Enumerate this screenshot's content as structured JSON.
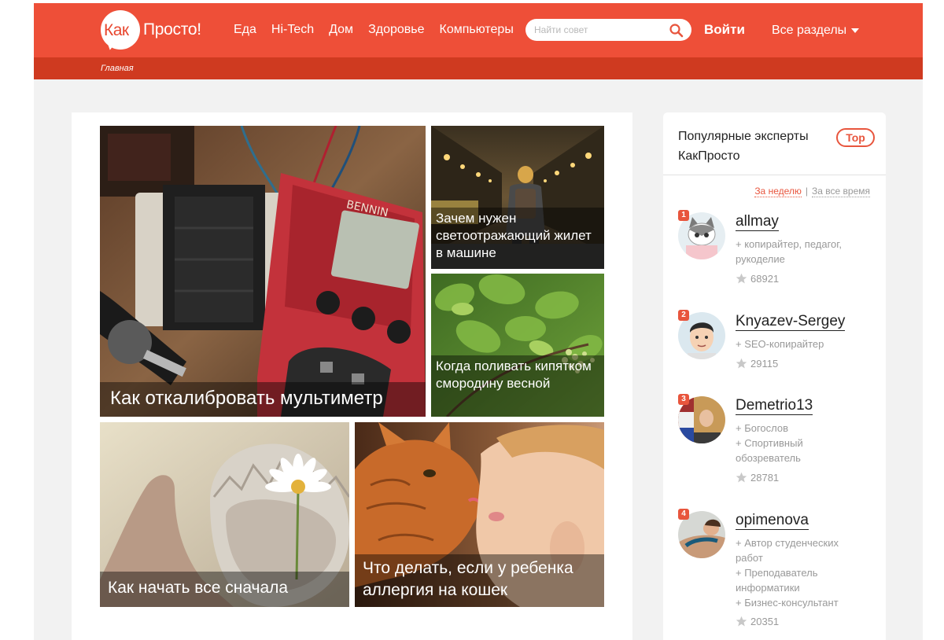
{
  "header": {
    "logo_kak": "Как",
    "logo_rest": "Просто!",
    "nav": [
      "Еда",
      "Hi-Tech",
      "Дом",
      "Здоровье",
      "Компьютеры"
    ],
    "search_placeholder": "Найти совет",
    "login": "Войти",
    "sections": "Все разделы",
    "accent_color": "#ee4f38"
  },
  "breadcrumb": {
    "home": "Главная"
  },
  "articles": [
    {
      "title": "Как откалибровать мультиметр",
      "icon": "multimeter-photo"
    },
    {
      "title": "Зачем нужен светоотражающий жилет в машине",
      "icon": "street-photo"
    },
    {
      "title": "Когда поливать кипятком смородину весной",
      "icon": "currant-photo"
    },
    {
      "title": "Как начать все сначала",
      "icon": "eggshell-flower-photo"
    },
    {
      "title": "Что делать, если у ребенка аллергия на кошек",
      "icon": "cat-child-photo"
    }
  ],
  "sidebar": {
    "heading": "Популярные эксперты КакПросто",
    "top_badge": "Top",
    "period_week": "За неделю",
    "period_all": "За все время",
    "experts": [
      {
        "rank": "1",
        "name": "allmay",
        "roles": [
          "+ копирайтер, педагог,",
          "рукоделие"
        ],
        "score": "68921"
      },
      {
        "rank": "2",
        "name": "Knyazev-Sergey",
        "roles": [
          "+ SEO-копирайтер"
        ],
        "score": "29115"
      },
      {
        "rank": "3",
        "name": "Demetrio13",
        "roles": [
          "+ Богослов",
          "+ Спортивный",
          "обозреватель"
        ],
        "score": "28781"
      },
      {
        "rank": "4",
        "name": "opimenova",
        "roles": [
          "+ Автор студенческих",
          "работ",
          "+ Преподаватель",
          "информатики",
          "+ Бизнес-консультант"
        ],
        "score": "20351"
      }
    ]
  }
}
